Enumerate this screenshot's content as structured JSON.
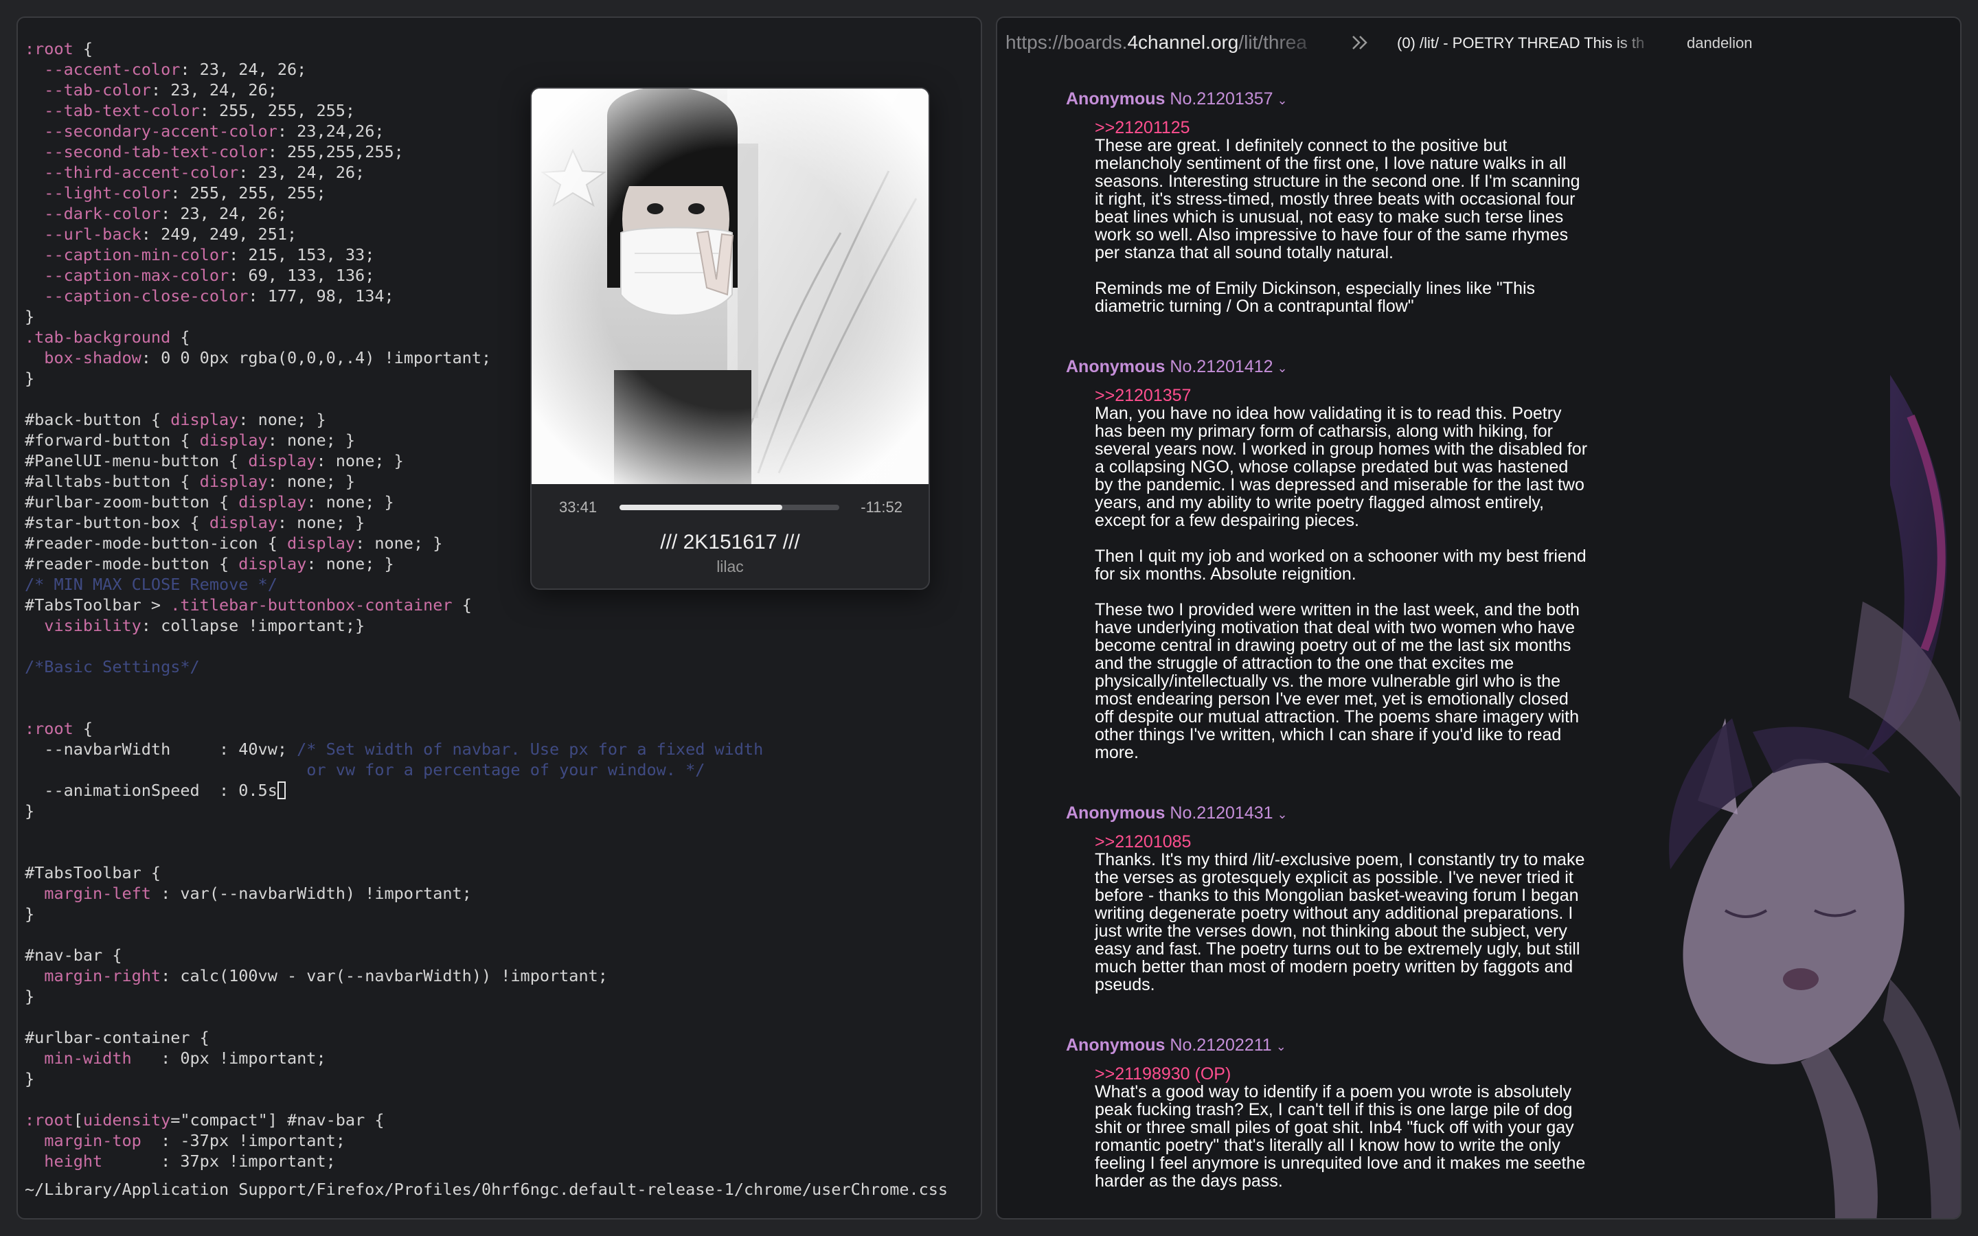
{
  "editor": {
    "statusline": "~/Library/Application Support/Firefox/Profiles/0hrf6ngc.default-release-1/chrome/userChrome.css"
  },
  "media": {
    "elapsed": "33:41",
    "remaining": "-11:52",
    "progress": 0.74,
    "track": "/// 2K151617 ///",
    "artist": "lilac"
  },
  "browser": {
    "url_prefix": "https://boards.",
    "url_domain": "4channel.org",
    "url_path": "/lit/threa",
    "tab1_title": "(0) /lit/ - POETRY THREAD This is th",
    "tab2_title": "dandelion",
    "posts": [
      {
        "name": "Anonymous",
        "number": "No.21201357",
        "quote": ">>21201125",
        "paragraphs": [
          "These are great. I definitely connect to the positive but melancholy sentiment of the first one, I love nature walks in all seasons. Interesting structure in the second one. If I'm scanning it right, it's stress-timed, mostly three beats with occasional four beat lines which is unusual, not easy to make such terse lines work so well. Also impressive to have four of the same rhymes per stanza that all sound totally natural.",
          "Reminds me of Emily Dickinson, especially lines like \"This diametric turning / On a contrapuntal flow\""
        ]
      },
      {
        "name": "Anonymous",
        "number": "No.21201412",
        "quote": ">>21201357",
        "paragraphs": [
          "Man, you have no idea how validating it is to read this. Poetry has been my primary form of catharsis, along with hiking, for several years now. I worked in group homes with the disabled for a collapsing NGO, whose collapse predated but was hastened by the pandemic. I was depressed and miserable for the last two years, and my ability to write poetry flagged almost entirely, except for a few despairing pieces.",
          "Then I quit my job and worked on a schooner with my best friend for six months. Absolute reignition.",
          "These two I provided were written in the last week, and the both have underlying motivation that deal with two women who have become central in drawing poetry out of me the last six months and the struggle of attraction to the one that excites me physically/intellectually vs. the more vulnerable girl who is the most endearing person I've ever met, yet is emotionally closed off despite our mutual attraction. The poems share imagery with other things I've written, which I can share if you'd like to read more."
        ]
      },
      {
        "name": "Anonymous",
        "number": "No.21201431",
        "quote": ">>21201085",
        "paragraphs": [
          "Thanks. It's my third /lit/-exclusive poem, I constantly try to make the verses as grotesquely explicit as possible. I've never tried it before - thanks to this Mongolian basket-weaving forum I began writing degenerate poetry without any additional preparations. I just write the verses down, not thinking about the subject, very easy and fast. The poetry turns out to be extremely ugly, but still much better than most of modern poetry written by faggots and pseuds."
        ]
      },
      {
        "name": "Anonymous",
        "number": "No.21202211",
        "quote": ">>21198930 (OP)",
        "paragraphs": [
          "What's a good way to identify if a poem you wrote is absolutely peak fucking trash? Ex, I can't tell if this is one large pile of dog shit or three small piles of goat shit. Inb4 \"fuck off with your gay romantic poetry\" that's literally all I know how to write the only feeling I feel anymore is unrequited love and it makes me seethe harder as the days pass."
        ]
      }
    ]
  },
  "colors": {
    "bg": "#232427",
    "selector": "#cc6fa6",
    "comment": "#3f4a82",
    "post_name": "#c58fd9",
    "quote_link": "#ff4f8f"
  }
}
